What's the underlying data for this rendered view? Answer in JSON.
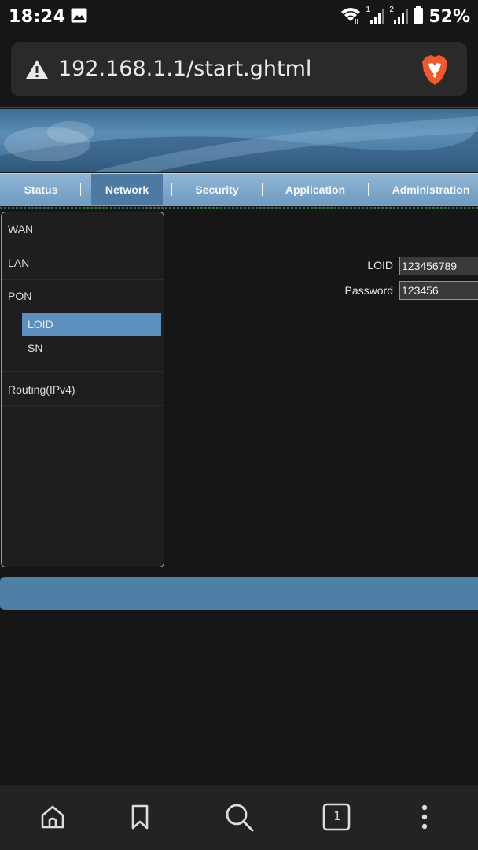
{
  "status_bar": {
    "time": "18:24",
    "battery_percent": "52%",
    "sim1_label": "1",
    "sim2_label": "2"
  },
  "url_bar": {
    "url": "192.168.1.1/start.ghtml",
    "warning_icon": "warning-triangle-icon",
    "brave_icon": "brave-lion-icon"
  },
  "nav": {
    "tabs": [
      {
        "label": "Status",
        "active": false
      },
      {
        "label": "Network",
        "active": true
      },
      {
        "label": "Security",
        "active": false
      },
      {
        "label": "Application",
        "active": false
      },
      {
        "label": "Administration",
        "active": false
      }
    ],
    "separator": "|"
  },
  "side_menu": {
    "items": [
      {
        "label": "WAN"
      },
      {
        "label": "LAN"
      },
      {
        "label": "PON"
      },
      {
        "label": "Routing(IPv4)"
      }
    ],
    "submenu": [
      {
        "label": "LOID",
        "active": true
      },
      {
        "label": "SN",
        "active": false
      }
    ]
  },
  "form": {
    "loid_label": "LOID",
    "loid_value": "123456789",
    "password_label": "Password",
    "password_value": "123456"
  },
  "bottom_nav": {
    "home_icon": "home-icon",
    "bookmark_icon": "bookmark-icon",
    "search_icon": "search-icon",
    "tab_count": "1",
    "menu_icon": "more-vertical-icon"
  },
  "colors": {
    "nav_bar": "#7ba5c9",
    "nav_active": "#4d7aa2",
    "submenu_active": "#5a8fbe",
    "footer_bar": "#4e7fa5",
    "background": "#161616"
  }
}
